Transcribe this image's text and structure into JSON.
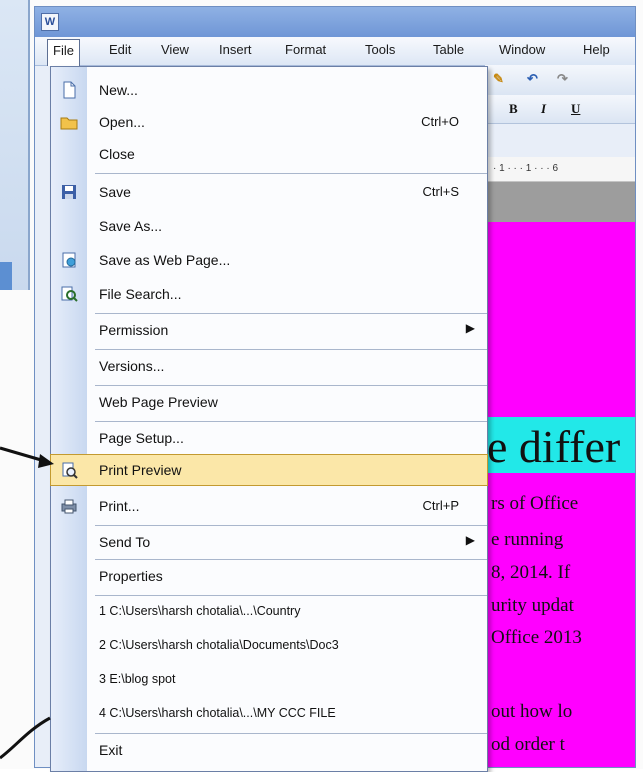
{
  "menubar": {
    "items": [
      "File",
      "Edit",
      "View",
      "Insert",
      "Format",
      "Tools",
      "Table",
      "Window",
      "Help"
    ]
  },
  "toolbar": {
    "bold": "B",
    "italic": "I",
    "underline": "U",
    "ruler": "· 1 · · · 1 · · · 6"
  },
  "document": {
    "heading": "e differ",
    "lines": [
      "rs of Office",
      "e running",
      "8, 2014. If",
      "urity updat",
      "Office 2013",
      "out how lo",
      "od order t"
    ]
  },
  "file_menu": {
    "items": [
      {
        "label": "New...",
        "shortcut": "",
        "icon": "new-document-icon"
      },
      {
        "label": "Open...",
        "shortcut": "Ctrl+O",
        "icon": "open-folder-icon"
      },
      {
        "label": "Close",
        "shortcut": "",
        "icon": ""
      },
      {
        "label": "Save",
        "shortcut": "Ctrl+S",
        "icon": "save-disk-icon"
      },
      {
        "label": "Save As...",
        "shortcut": "",
        "icon": ""
      },
      {
        "label": "Save as Web Page...",
        "shortcut": "",
        "icon": "web-page-icon"
      },
      {
        "label": "File Search...",
        "shortcut": "",
        "icon": "file-search-icon"
      },
      {
        "label": "Permission",
        "shortcut": "",
        "icon": "",
        "submenu": true
      },
      {
        "label": "Versions...",
        "shortcut": "",
        "icon": ""
      },
      {
        "label": "Web Page Preview",
        "shortcut": "",
        "icon": ""
      },
      {
        "label": "Page Setup...",
        "shortcut": "",
        "icon": ""
      },
      {
        "label": "Print Preview",
        "shortcut": "",
        "icon": "print-preview-icon",
        "highlighted": true
      },
      {
        "label": "Print...",
        "shortcut": "Ctrl+P",
        "icon": "printer-icon"
      },
      {
        "label": "Send To",
        "shortcut": "",
        "icon": "",
        "submenu": true
      },
      {
        "label": "Properties",
        "shortcut": "",
        "icon": ""
      },
      {
        "label": "1 C:\\Users\\harsh chotalia\\...\\Country",
        "shortcut": "",
        "icon": ""
      },
      {
        "label": "2 C:\\Users\\harsh chotalia\\Documents\\Doc3",
        "shortcut": "",
        "icon": ""
      },
      {
        "label": "3 E:\\blog spot",
        "shortcut": "",
        "icon": ""
      },
      {
        "label": "4 C:\\Users\\harsh chotalia\\...\\MY CCC FILE",
        "shortcut": "",
        "icon": ""
      },
      {
        "label": "Exit",
        "shortcut": "",
        "icon": ""
      }
    ]
  },
  "colors": {
    "document_background": "#ff00ff",
    "heading_background": "#22e8e8",
    "menu_highlight": "#fbe7a8"
  }
}
